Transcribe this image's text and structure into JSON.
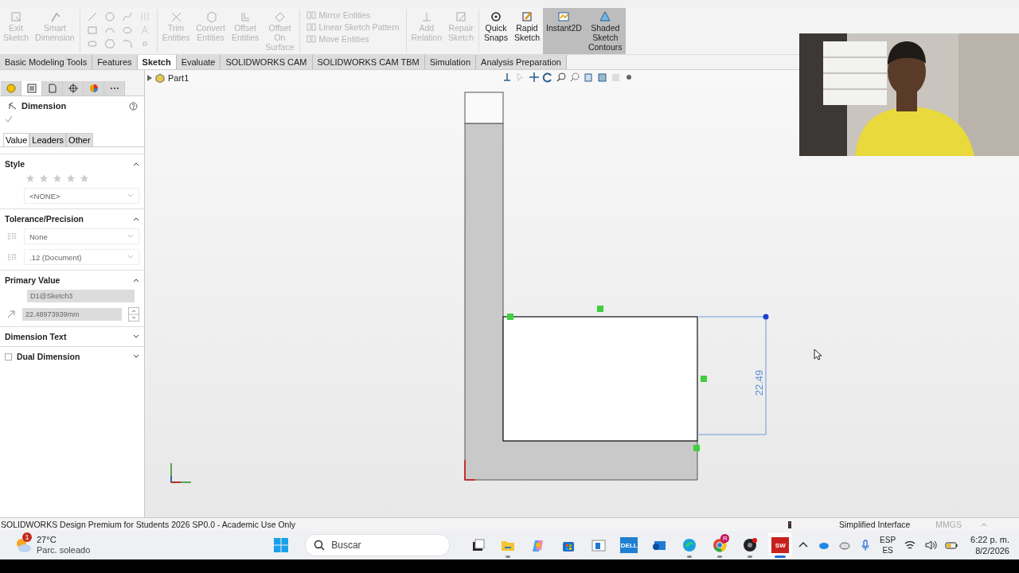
{
  "ribbon": [
    {
      "kind": "large",
      "label": "Exit Sketch",
      "disabled": true,
      "selected": false
    },
    {
      "kind": "large",
      "label": "Smart Dimension",
      "disabled": true,
      "selected": false
    },
    {
      "kind": "grid"
    },
    {
      "kind": "large",
      "label": "Trim Entities",
      "disabled": true,
      "selected": false
    },
    {
      "kind": "large",
      "label": "Convert Entities",
      "disabled": true,
      "selected": false
    },
    {
      "kind": "large",
      "label": "Offset Entities",
      "disabled": true,
      "selected": false
    },
    {
      "kind": "large",
      "label": "Offset On Surface",
      "disabled": true,
      "selected": false
    },
    {
      "kind": "stack",
      "items": [
        {
          "label": "Mirror Entities",
          "disabled": true
        },
        {
          "label": "Linear Sketch Pattern",
          "disabled": true
        },
        {
          "label": "Move Entities",
          "disabled": true
        }
      ]
    },
    {
      "kind": "large",
      "label": "Add Relation",
      "disabled": true,
      "selected": false
    },
    {
      "kind": "large",
      "label": "Repair Sketch",
      "disabled": true,
      "selected": false
    },
    {
      "kind": "large",
      "label": "Quick Snaps",
      "disabled": false,
      "selected": false
    },
    {
      "kind": "large",
      "label": "Rapid Sketch",
      "disabled": false,
      "selected": false
    },
    {
      "kind": "large",
      "label": "Instant2D",
      "disabled": false,
      "selected": true
    },
    {
      "kind": "large",
      "label": "Shaded Sketch Contours",
      "disabled": false,
      "selected": true
    }
  ],
  "command_tabs": [
    {
      "label": "Basic Modeling Tools",
      "selected": false
    },
    {
      "label": "Features",
      "selected": false
    },
    {
      "label": "Sketch",
      "selected": true
    },
    {
      "label": "Evaluate",
      "selected": false
    },
    {
      "label": "SOLIDWORKS CAM",
      "selected": false
    },
    {
      "label": "SOLIDWORKS CAM TBM",
      "selected": false
    },
    {
      "label": "Simulation",
      "selected": false
    },
    {
      "label": "Analysis Preparation",
      "selected": false
    }
  ],
  "panel": {
    "icon_tabs": [
      {
        "kind": "feature",
        "selected": false
      },
      {
        "kind": "property",
        "selected": true
      },
      {
        "kind": "config",
        "selected": false
      },
      {
        "kind": "target",
        "selected": false
      },
      {
        "kind": "display",
        "selected": false
      },
      {
        "kind": "more",
        "label": "⋯",
        "selected": false
      }
    ],
    "title": "Dimension",
    "tabs": [
      {
        "label": "Value",
        "selected": true
      },
      {
        "label": "Leaders",
        "selected": false
      },
      {
        "label": "Other",
        "selected": false
      }
    ],
    "sections": [
      {
        "kind": "style",
        "title": "Style",
        "expanded": true,
        "dropdown": "<NONE>"
      },
      {
        "kind": "tolerance",
        "title": "Tolerance/Precision",
        "expanded": true,
        "dropdowns": [
          "None",
          ".12 (Document)"
        ]
      },
      {
        "kind": "primary",
        "title": "Primary Value",
        "expanded": true,
        "name_field": "D1@Sketch3",
        "value_field": "22.48973939mm"
      },
      {
        "kind": "plain",
        "title": "Dimension Text",
        "expanded": false
      },
      {
        "kind": "check",
        "title": "Dual Dimension",
        "expanded": false,
        "checked": false
      }
    ]
  },
  "graphics": {
    "tree_label": "Part1",
    "dimension_label": "22.49"
  },
  "status_bar": {
    "text": "SOLIDWORKS Design Premium for Students 2026 SP0.0 - Academic Use Only",
    "interface": "Simplified Interface",
    "units": "MMGS"
  },
  "taskbar": {
    "weather": {
      "temp": "27°C",
      "condition": "Parc. soleado",
      "badge": "1"
    },
    "search": {
      "placeholder": "Buscar"
    },
    "apps": [
      {
        "kind": "taskview",
        "running": false,
        "active": false
      },
      {
        "kind": "explorer",
        "running": true,
        "active": false
      },
      {
        "kind": "copilot",
        "running": false,
        "active": false
      },
      {
        "kind": "store",
        "running": false,
        "active": false
      },
      {
        "kind": "window",
        "running": false,
        "active": false
      },
      {
        "kind": "dell",
        "label": "DELL",
        "running": false,
        "active": false
      },
      {
        "kind": "outlook",
        "running": false,
        "active": false
      },
      {
        "kind": "edge",
        "running": true,
        "active": false
      },
      {
        "kind": "chrome",
        "badge": "R",
        "running": true,
        "active": false
      },
      {
        "kind": "obs",
        "running": true,
        "active": false
      },
      {
        "kind": "solidworks",
        "label": "SW",
        "running": true,
        "active": true
      }
    ],
    "language": "ESP",
    "layout": "ES",
    "time": "6:22 p. m.",
    "date": "8/2/2026"
  }
}
